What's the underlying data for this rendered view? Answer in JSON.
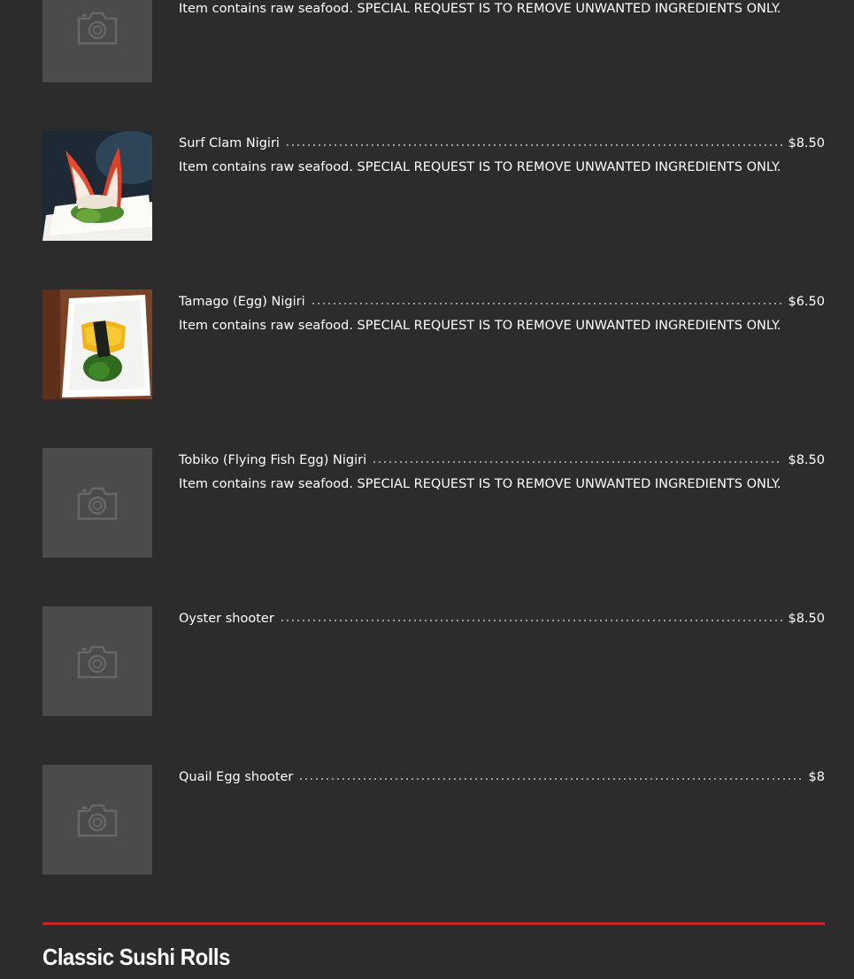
{
  "items": [
    {
      "name": "",
      "price": "",
      "description": "Item contains raw seafood. SPECIAL REQUEST IS TO REMOVE UNWANTED INGREDIENTS ONLY.",
      "image": "camera-placeholder-icon"
    },
    {
      "name": "Surf Clam Nigiri",
      "price": "$8.50",
      "description": "Item contains raw seafood. SPECIAL REQUEST IS TO REMOVE UNWANTED INGREDIENTS ONLY.",
      "image": "surf-clam-photo"
    },
    {
      "name": "Tamago (Egg) Nigiri",
      "price": "$6.50",
      "description": "Item contains raw seafood. SPECIAL REQUEST IS TO REMOVE UNWANTED INGREDIENTS ONLY.",
      "image": "tamago-photo"
    },
    {
      "name": "Tobiko (Flying Fish Egg) Nigiri",
      "price": "$8.50",
      "description": "Item contains raw seafood. SPECIAL REQUEST IS TO REMOVE UNWANTED INGREDIENTS ONLY.",
      "image": "camera-placeholder-icon"
    },
    {
      "name": "Oyster shooter",
      "price": "$8.50",
      "description": "",
      "image": "camera-placeholder-icon"
    },
    {
      "name": "Quail Egg shooter",
      "price": "$8",
      "description": "",
      "image": "camera-placeholder-icon"
    }
  ],
  "next_section": {
    "title": "Classic Sushi Rolls"
  },
  "colors": {
    "background": "#2c2c2d",
    "placeholder": "#4b4b4c",
    "divider": "#bf2a22",
    "text": "#ffffff"
  }
}
